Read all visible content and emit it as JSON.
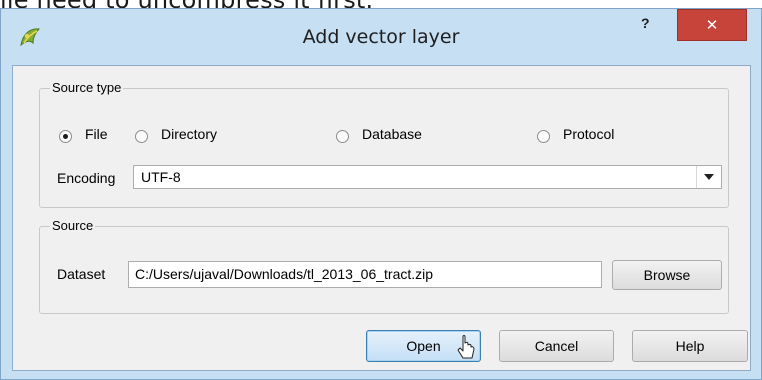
{
  "background_doc": {
    "visible_text": "ile need to uncompress it first."
  },
  "window": {
    "title": "Add vector layer",
    "help_glyph": "?",
    "close_glyph": "✕",
    "app_icon": "qgis-icon"
  },
  "source_type": {
    "legend": "Source type",
    "options": [
      {
        "label": "File",
        "checked": true
      },
      {
        "label": "Directory",
        "checked": false
      },
      {
        "label": "Database",
        "checked": false
      },
      {
        "label": "Protocol",
        "checked": false
      }
    ],
    "encoding_label": "Encoding",
    "encoding_value": "UTF-8"
  },
  "source": {
    "legend": "Source",
    "dataset_label": "Dataset",
    "dataset_value": "C:/Users/ujaval/Downloads/tl_2013_06_tract.zip",
    "browse_label": "Browse"
  },
  "buttons": {
    "open": "Open",
    "cancel": "Cancel",
    "help": "Help"
  },
  "colors": {
    "frame": "#c6dff3",
    "close_button": "#c7443b",
    "client": "#f0f0f0"
  }
}
